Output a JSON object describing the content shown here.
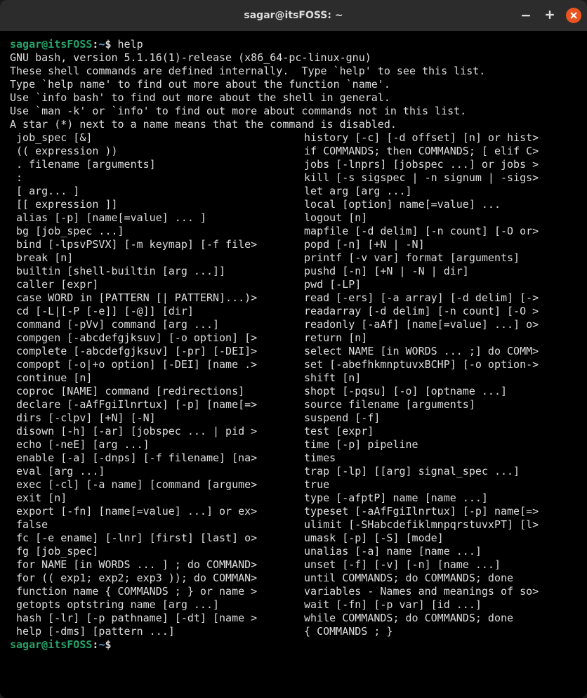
{
  "window": {
    "title": "sagar@itsFOSS: ~"
  },
  "prompt": {
    "user_host": "sagar@itsFOSS",
    "separator": ":",
    "path": "~",
    "dollar": "$"
  },
  "command": "help",
  "intro": {
    "l1": "GNU bash, version 5.1.16(1)-release (x86_64-pc-linux-gnu)",
    "l2": "These shell commands are defined internally.  Type `help' to see this list.",
    "l3": "Type `help name' to find out more about the function `name'.",
    "l4": "Use `info bash' to find out more about the shell in general.",
    "l5": "Use `man -k' or `info' to find out more about commands not in this list.",
    "l6": "",
    "l7": "A star (*) next to a name means that the command is disabled.",
    "l8": ""
  },
  "left": [
    " job_spec [&]",
    " (( expression ))",
    " . filename [arguments]",
    " :",
    " [ arg... ]",
    " [[ expression ]]",
    " alias [-p] [name[=value] ... ]",
    " bg [job_spec ...]",
    " bind [-lpsvPSVX] [-m keymap] [-f file>",
    " break [n]",
    " builtin [shell-builtin [arg ...]]",
    " caller [expr]",
    " case WORD in [PATTERN [| PATTERN]...)>",
    " cd [-L|[-P [-e]] [-@]] [dir]",
    " command [-pVv] command [arg ...]",
    " compgen [-abcdefgjksuv] [-o option] [>",
    " complete [-abcdefgjksuv] [-pr] [-DEI]>",
    " compopt [-o|+o option] [-DEI] [name .>",
    " continue [n]",
    " coproc [NAME] command [redirections]",
    " declare [-aAfFgiIlnrtux] [-p] [name[=>",
    " dirs [-clpv] [+N] [-N]",
    " disown [-h] [-ar] [jobspec ... | pid >",
    " echo [-neE] [arg ...]",
    " enable [-a] [-dnps] [-f filename] [na>",
    " eval [arg ...]",
    " exec [-cl] [-a name] [command [argume>",
    " exit [n]",
    " export [-fn] [name[=value] ...] or ex>",
    " false",
    " fc [-e ename] [-lnr] [first] [last] o>",
    " fg [job_spec]",
    " for NAME [in WORDS ... ] ; do COMMAND>",
    " for (( exp1; exp2; exp3 )); do COMMAN>",
    " function name { COMMANDS ; } or name >",
    " getopts optstring name [arg ...]",
    " hash [-lr] [-p pathname] [-dt] [name >",
    " help [-dms] [pattern ...]"
  ],
  "right": [
    " history [-c] [-d offset] [n] or hist>",
    " if COMMANDS; then COMMANDS; [ elif C>",
    " jobs [-lnprs] [jobspec ...] or jobs >",
    " kill [-s sigspec | -n signum | -sigs>",
    " let arg [arg ...]",
    " local [option] name[=value] ...",
    " logout [n]",
    " mapfile [-d delim] [-n count] [-O or>",
    " popd [-n] [+N | -N]",
    " printf [-v var] format [arguments]",
    " pushd [-n] [+N | -N | dir]",
    " pwd [-LP]",
    " read [-ers] [-a array] [-d delim] [->",
    " readarray [-d delim] [-n count] [-O >",
    " readonly [-aAf] [name[=value] ...] o>",
    " return [n]",
    " select NAME [in WORDS ... ;] do COMM>",
    " set [-abefhkmnptuvxBCHP] [-o option->",
    " shift [n]",
    " shopt [-pqsu] [-o] [optname ...]",
    " source filename [arguments]",
    " suspend [-f]",
    " test [expr]",
    " time [-p] pipeline",
    " times",
    " trap [-lp] [[arg] signal_spec ...]",
    " true",
    " type [-afptP] name [name ...]",
    " typeset [-aAfFgiIlnrtux] [-p] name[=>",
    " ulimit [-SHabcdefiklmnpqrstuvxPT] [l>",
    " umask [-p] [-S] [mode]",
    " unalias [-a] name [name ...]",
    " unset [-f] [-v] [-n] [name ...]",
    " until COMMANDS; do COMMANDS; done",
    " variables - Names and meanings of so>",
    " wait [-fn] [-p var] [id ...]",
    " while COMMANDS; do COMMANDS; done",
    " { COMMANDS ; }"
  ]
}
